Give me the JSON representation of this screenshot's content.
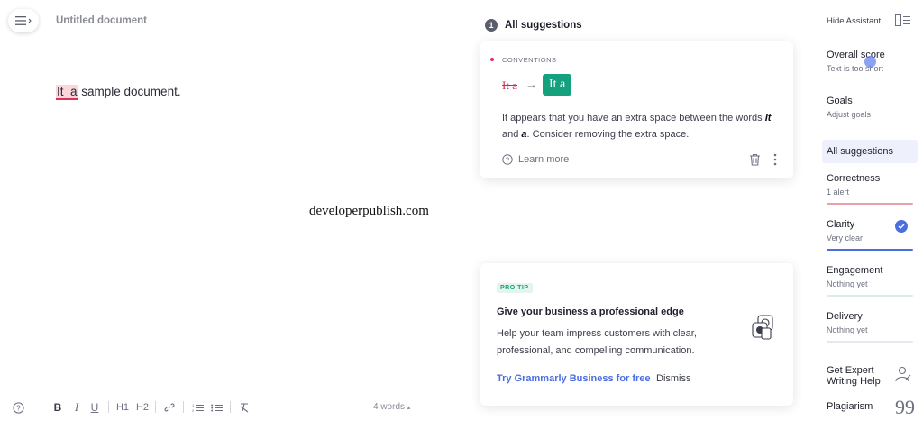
{
  "editor": {
    "doc_title": "Untitled document",
    "body_flagged": "It  a",
    "body_rest": " sample document.",
    "watermark": "developerpublish.com",
    "word_count": "4 words",
    "word_count_caret": "▴",
    "toolbar": {
      "bold": "B",
      "italic": "I",
      "underline": "U",
      "h1": "H1",
      "h2": "H2"
    }
  },
  "suggestions": {
    "count": "1",
    "title": "All suggestions",
    "card": {
      "category": "CONVENTIONS",
      "original": "It a",
      "arrow": "→",
      "replacement": "It a",
      "text_1": "It appears that you have an extra space between the words ",
      "word_1": "It",
      "text_2": " and ",
      "word_2": "a",
      "text_3": ". Consider removing the extra space.",
      "learn_more": "Learn more"
    },
    "tip": {
      "badge": "PRO TIP",
      "heading": "Give your business a professional edge",
      "body": "Help your team impress customers with clear, professional, and compelling communication.",
      "cta": "Try Grammarly Business for free",
      "dismiss": "Dismiss"
    }
  },
  "sidebar": {
    "hide_assistant": "Hide Assistant",
    "overall": {
      "name": "Overall score",
      "sub": "Text is too short"
    },
    "goals": {
      "name": "Goals",
      "sub": "Adjust goals"
    },
    "all_suggestions": "All suggestions",
    "correctness": {
      "name": "Correctness",
      "sub": "1 alert",
      "color": "#e8a0ae"
    },
    "clarity": {
      "name": "Clarity",
      "sub": "Very clear",
      "color": "#4a6ee0"
    },
    "engagement": {
      "name": "Engagement",
      "sub": "Nothing yet",
      "color": "#d5efe5"
    },
    "delivery": {
      "name": "Delivery",
      "sub": "Nothing yet",
      "color": "#e6e7ef"
    },
    "expert": {
      "line1": "Get Expert",
      "line2": "Writing Help"
    },
    "plagiarism": "Plagiarism",
    "plagiarism_glyph": "99"
  }
}
